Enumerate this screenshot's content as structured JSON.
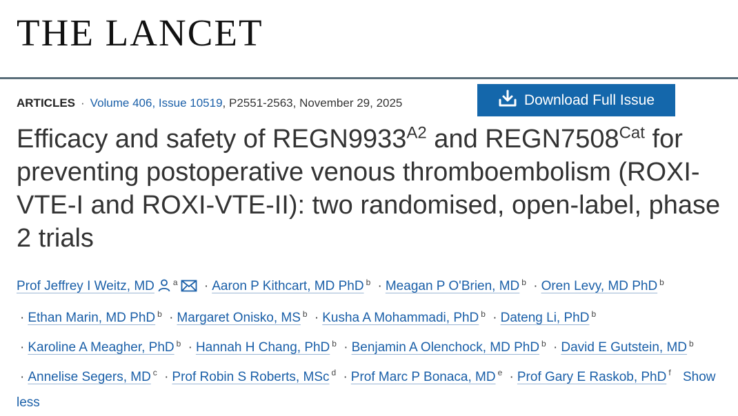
{
  "journal": {
    "name": "THE LANCET"
  },
  "meta": {
    "section": "ARTICLES",
    "volume_link": "Volume 406, Issue 10519",
    "pages_date": ", P2551-2563, November 29, 2025",
    "download_label": "Download Full Issue"
  },
  "article": {
    "title_part1": "Efficacy and safety of REGN9933",
    "title_sup1": "A2",
    "title_part2": " and REGN7508",
    "title_sup2": "Cat",
    "title_part3": " for preventing postoperative venous thromboembolism (ROXI-VTE-I and ROXI-VTE-II): two randomised, open-label, phase 2 trials"
  },
  "authors": [
    {
      "name": "Prof Jeffrey I Weitz, MD",
      "aff": "a"
    },
    {
      "name": "Aaron P Kithcart, MD PhD",
      "aff": "b"
    },
    {
      "name": "Meagan P O'Brien, MD",
      "aff": "b"
    },
    {
      "name": "Oren Levy, MD PhD",
      "aff": "b"
    },
    {
      "name": "Ethan Marin, MD PhD",
      "aff": "b"
    },
    {
      "name": "Margaret Onisko, MS",
      "aff": "b"
    },
    {
      "name": "Kusha A Mohammadi, PhD",
      "aff": "b"
    },
    {
      "name": "Dateng Li, PhD",
      "aff": "b"
    },
    {
      "name": "Karoline A Meagher, PhD",
      "aff": "b"
    },
    {
      "name": "Hannah H Chang, PhD",
      "aff": "b"
    },
    {
      "name": "Benjamin A Olenchock, MD PhD",
      "aff": "b"
    },
    {
      "name": "David E Gutstein, MD",
      "aff": "b"
    },
    {
      "name": "Annelise Segers, MD",
      "aff": "c"
    },
    {
      "name": "Prof Robin S Roberts, MSc",
      "aff": "d"
    },
    {
      "name": "Prof Marc P Bonaca, MD",
      "aff": "e"
    },
    {
      "name": "Prof Gary E Raskob, PhD",
      "aff": "f"
    }
  ],
  "show_less_label": "Show less",
  "separator": "·"
}
